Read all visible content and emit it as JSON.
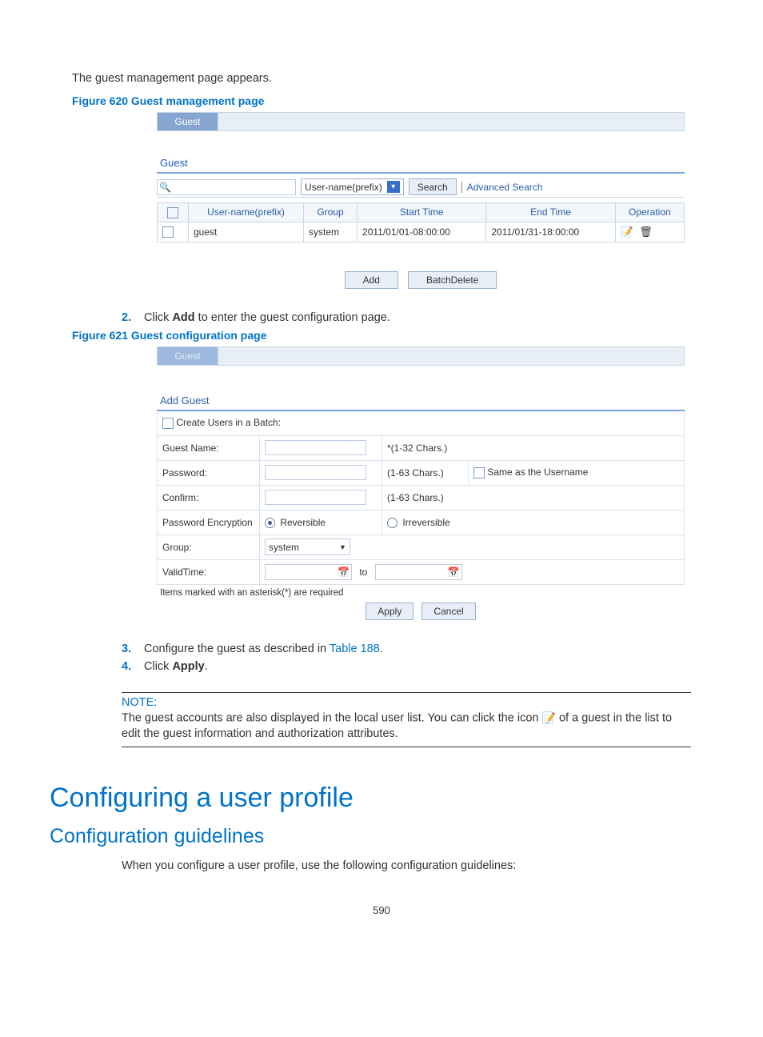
{
  "intro": "The guest management page appears.",
  "fig620": {
    "caption": "Figure 620 Guest management page",
    "tab": "Guest",
    "section": "Guest",
    "select_label": "User-name(prefix)",
    "search_btn": "Search",
    "adv": "Advanced Search",
    "cols": {
      "c1": "User-name(prefix)",
      "c2": "Group",
      "c3": "Start Time",
      "c4": "End Time",
      "c5": "Operation"
    },
    "row": {
      "name": "guest",
      "group": "system",
      "start": "2011/01/01-08:00:00",
      "end": "2011/01/31-18:00:00"
    },
    "add": "Add",
    "batch": "BatchDelete"
  },
  "step2": {
    "num": "2.",
    "text_a": "Click ",
    "bold": "Add",
    "text_b": " to enter the guest configuration page."
  },
  "fig621": {
    "caption": "Figure 621 Guest configuration page",
    "tab": "Guest",
    "heading": "Add Guest",
    "r1": "Create Users in a Batch:",
    "r2l": "Guest Name:",
    "r2h": "*(1-32 Chars.)",
    "r3l": "Password:",
    "r3h": "(1-63 Chars.)",
    "r3c": "Same as the Username",
    "r4l": "Confirm:",
    "r4h": "(1-63 Chars.)",
    "r5l": "Password Encryption",
    "r5a": "Reversible",
    "r5b": "Irreversible",
    "r6l": "Group:",
    "r6v": "system",
    "r7l": "ValidTime:",
    "r7m": "to",
    "req": "Items marked with an asterisk(*) are required",
    "apply": "Apply",
    "cancel": "Cancel"
  },
  "step3": {
    "num": "3.",
    "text_a": "Configure the guest as described in ",
    "link": "Table 188",
    "text_b": "."
  },
  "step4": {
    "num": "4.",
    "text_a": "Click ",
    "bold": "Apply",
    "text_b": "."
  },
  "note": {
    "label": "NOTE:",
    "a": "The guest accounts are also displayed in the local user list. You can click the icon ",
    "b": " of a guest in the list to edit the guest information and authorization attributes."
  },
  "h1": "Configuring a user profile",
  "h2": "Configuration guidelines",
  "guideline": "When you configure a user profile, use the following configuration guidelines:",
  "pagenum": "590"
}
